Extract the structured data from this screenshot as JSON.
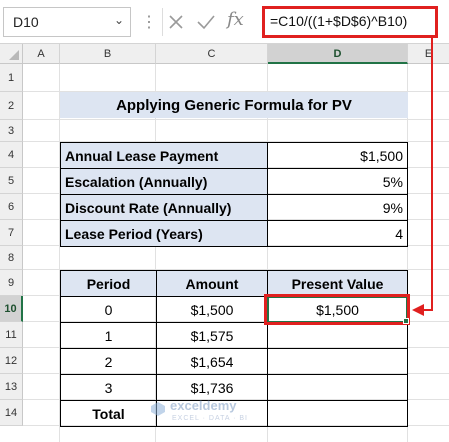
{
  "name_box": "D10",
  "formula": "=C10/((1+$D$6)^B10)",
  "columns": [
    "A",
    "B",
    "C",
    "D",
    "E"
  ],
  "rows": [
    "1",
    "2",
    "3",
    "4",
    "5",
    "6",
    "7",
    "8",
    "9",
    "10",
    "11",
    "12",
    "13",
    "14"
  ],
  "selected_cell": "D10",
  "title": "Applying Generic Formula for PV",
  "inputs": [
    {
      "label": "Annual Lease Payment",
      "value": "$1,500"
    },
    {
      "label": "Escalation (Annually)",
      "value": "5%"
    },
    {
      "label": "Discount Rate (Annually)",
      "value": "9%"
    },
    {
      "label": "Lease Period (Years)",
      "value": "4"
    }
  ],
  "table": {
    "headers": [
      "Period",
      "Amount",
      "Present Value"
    ],
    "rows": [
      {
        "period": "0",
        "amount": "$1,500",
        "pv": "$1,500"
      },
      {
        "period": "1",
        "amount": "$1,575",
        "pv": ""
      },
      {
        "period": "2",
        "amount": "$1,654",
        "pv": ""
      },
      {
        "period": "3",
        "amount": "$1,736",
        "pv": ""
      }
    ],
    "total_label": "Total"
  },
  "watermark": {
    "name": "exceldemy",
    "tagline": "EXCEL · DATA · BI"
  },
  "colors": {
    "accent": "#e0201f",
    "header_fill": "#dde5f2",
    "selection": "#217346"
  }
}
